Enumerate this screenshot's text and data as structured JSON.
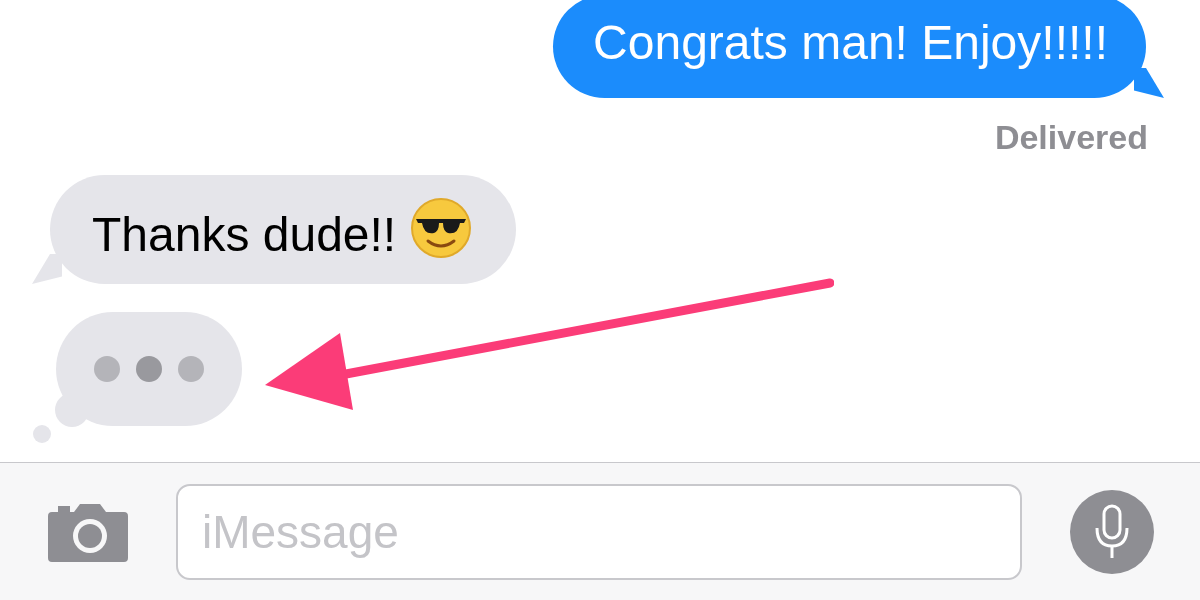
{
  "messages": [
    {
      "kind": "sent",
      "text": "Congrats man! Enjoy!!!!!"
    },
    {
      "kind": "status",
      "text": "Delivered"
    },
    {
      "kind": "received",
      "text": "Thanks dude!!",
      "emoji": true
    },
    {
      "kind": "typing"
    }
  ],
  "composer": {
    "placeholder": "iMessage"
  }
}
